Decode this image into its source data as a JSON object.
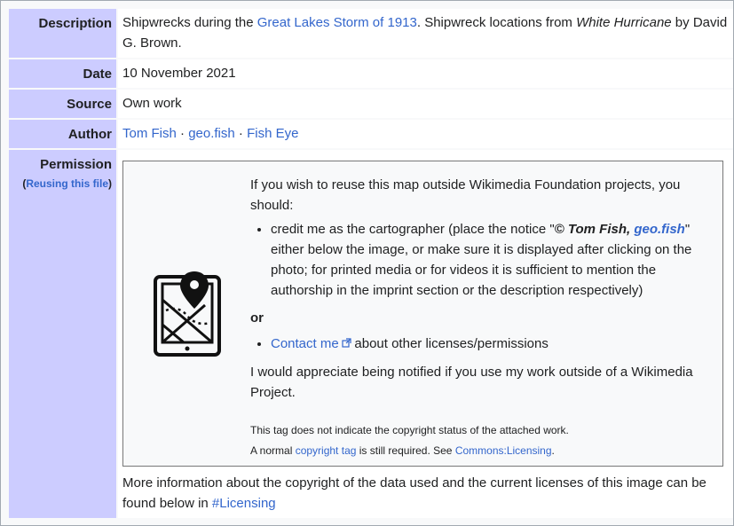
{
  "rows": {
    "description": {
      "label": "Description",
      "text_1": "Shipwrecks during the ",
      "link": "Great Lakes Storm of 1913",
      "text_2": ". Shipwreck locations from ",
      "book": "White Hurricane",
      "text_3": " by David G. Brown."
    },
    "date": {
      "label": "Date",
      "value": "10 November 2021"
    },
    "source": {
      "label": "Source",
      "value": "Own work"
    },
    "author": {
      "label": "Author",
      "link_1": "Tom Fish",
      "sep_1": " · ",
      "link_2": "geo.fish",
      "sep_2": " · ",
      "link_3": "Fish Eye"
    },
    "permission": {
      "label": "Permission",
      "sublink_open": "(",
      "sublink": "Reusing this file",
      "sublink_close": ")",
      "intro": "If you wish to reuse this map outside Wikimedia Foundation projects, you should:",
      "bullet_1_a": "credit me as the cartographer (place the notice \"",
      "bullet_1_notice": "© Tom Fish, ",
      "bullet_1_notice_link": "geo.fish",
      "bullet_1_b": "\" either below the image, or make sure it is displayed after clicking on the photo; for printed media or for videos it is sufficient to mention the authorship in the imprint section or the description respectively)",
      "or": "or",
      "bullet_2_link": "Contact me",
      "bullet_2_text": " about other licenses/permissions",
      "notify": "I would appreciate being notified if you use my work outside of a Wikimedia Project.",
      "note_1": "This tag does not indicate the copyright status of the attached work.",
      "note_2_a": "A normal ",
      "note_2_link": "copyright tag",
      "note_2_b": " is still required. See ",
      "note_2_link_2": "Commons:Licensing",
      "note_2_c": ".",
      "footer_text": "More information about the copyright of the data used and the current licenses of this image can be found below in ",
      "footer_link": "#Licensing"
    }
  },
  "icons": {
    "map_tablet": "map-tablet-icon",
    "external_link": "external-link-icon"
  },
  "colors": {
    "label_bg": "#ccccff",
    "link": "#3366cc",
    "border": "#a2a9b1"
  }
}
